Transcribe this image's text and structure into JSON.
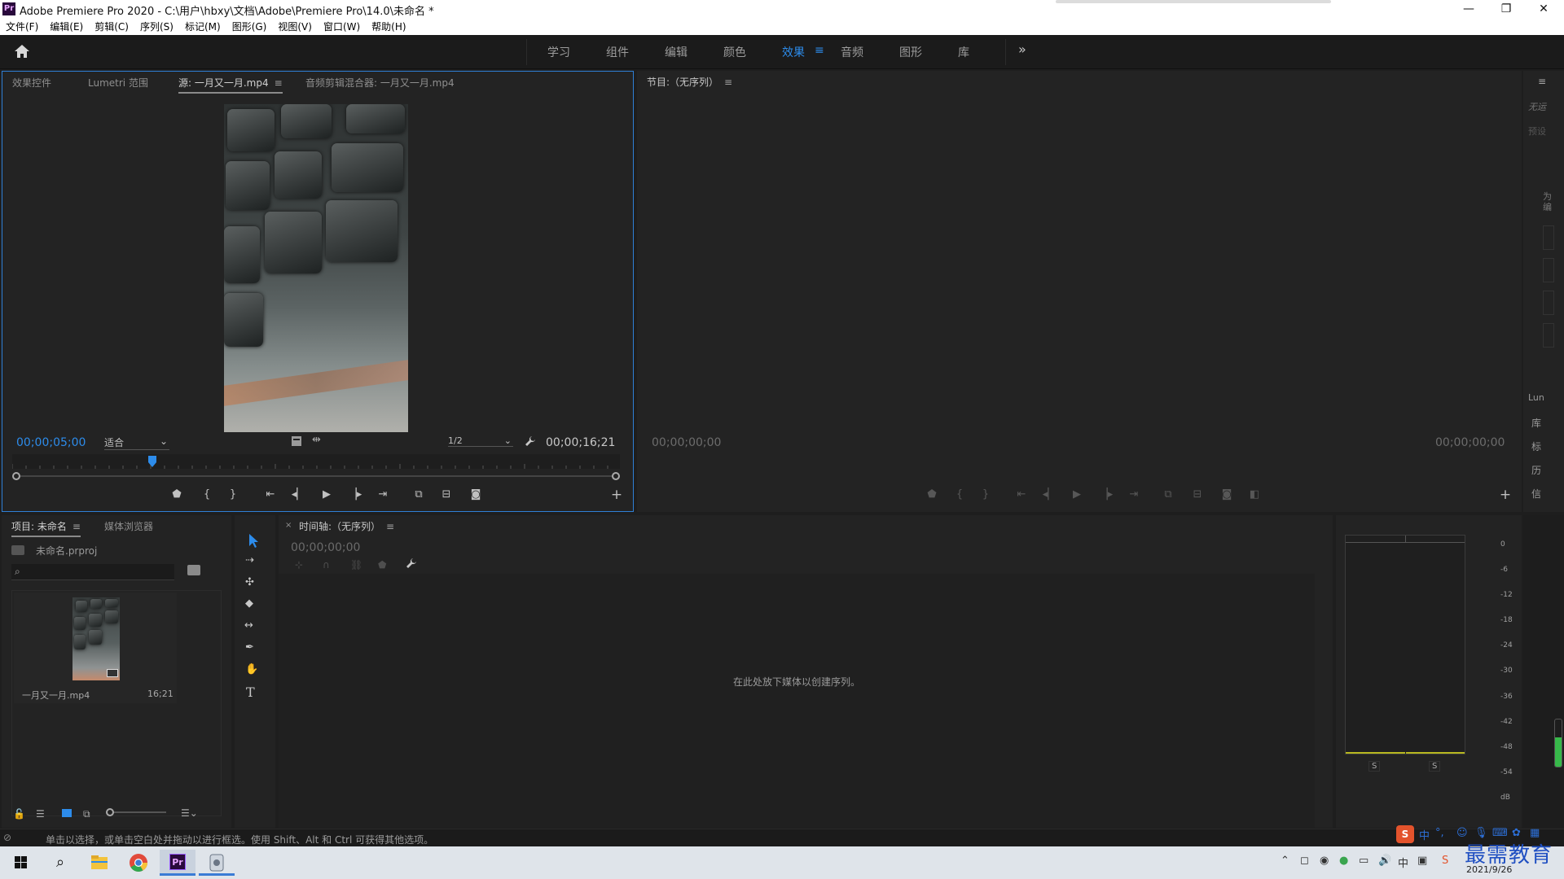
{
  "titlebar": {
    "logo": "Pr",
    "title": "Adobe Premiere Pro 2020 - C:\\用户\\hbxy\\文档\\Adobe\\Premiere Pro\\14.0\\未命名 *",
    "minimize": "—",
    "maximize": "❐",
    "close": "✕"
  },
  "menubar": {
    "items": [
      "文件(F)",
      "编辑(E)",
      "剪辑(C)",
      "序列(S)",
      "标记(M)",
      "图形(G)",
      "视图(V)",
      "窗口(W)",
      "帮助(H)"
    ]
  },
  "workspaces": {
    "tabs": [
      "学习",
      "组件",
      "编辑",
      "颜色",
      "效果",
      "音频",
      "图形",
      "库"
    ],
    "active": "效果",
    "active_menu": "≡",
    "overflow": "»"
  },
  "source_panel": {
    "tabs": [
      "效果控件",
      "Lumetri 范围",
      "源: 一月又一月.mp4",
      "音频剪辑混合器: 一月又一月.mp4"
    ],
    "active_tab_index": 2,
    "menu": "≡",
    "current_time": "00;00;05;00",
    "zoom": "适合",
    "resolution": "1/2",
    "duration": "00;00;16;21",
    "playhead_fraction": 0.23
  },
  "program_panel": {
    "title": "节目:（无序列）",
    "menu": "≡",
    "current_time": "00;00;00;00",
    "duration": "00;00;00;00"
  },
  "right_strip": {
    "menu": "≡",
    "items": [
      "无运",
      "预设",
      "为编",
      "Lun",
      "库",
      "标",
      "历",
      "信"
    ]
  },
  "project_panel": {
    "tabs": [
      "项目: 未命名",
      "媒体浏览器"
    ],
    "menu": "≡",
    "project_file": "未命名.prproj",
    "search_placeholder": "",
    "items": [
      {
        "name": "一月又一月.mp4",
        "duration": "16;21"
      }
    ]
  },
  "timeline_panel": {
    "close": "×",
    "title": "时间轴:（无序列）",
    "menu": "≡",
    "current_time": "00;00;00;00",
    "empty_message": "在此处放下媒体以创建序列。"
  },
  "audio_meter": {
    "db_labels": [
      "0",
      "-6",
      "-12",
      "-18",
      "-24",
      "-30",
      "-36",
      "-42",
      "-48",
      "-54",
      "dB"
    ],
    "solo_left": "S",
    "solo_right": "S"
  },
  "statusbar": {
    "text": "单击以选择，或单击空白处并拖动以进行框选。使用 Shift、Alt 和 Ctrl 可获得其他选项。"
  },
  "taskbar": {
    "date": "2021/9/26",
    "ime": "中",
    "watermark": "最需教育",
    "premiere_label": "Pr"
  },
  "colors": {
    "accent": "#2d8ceb",
    "panel_bg": "#232323",
    "app_bg": "#1e1e1e"
  }
}
